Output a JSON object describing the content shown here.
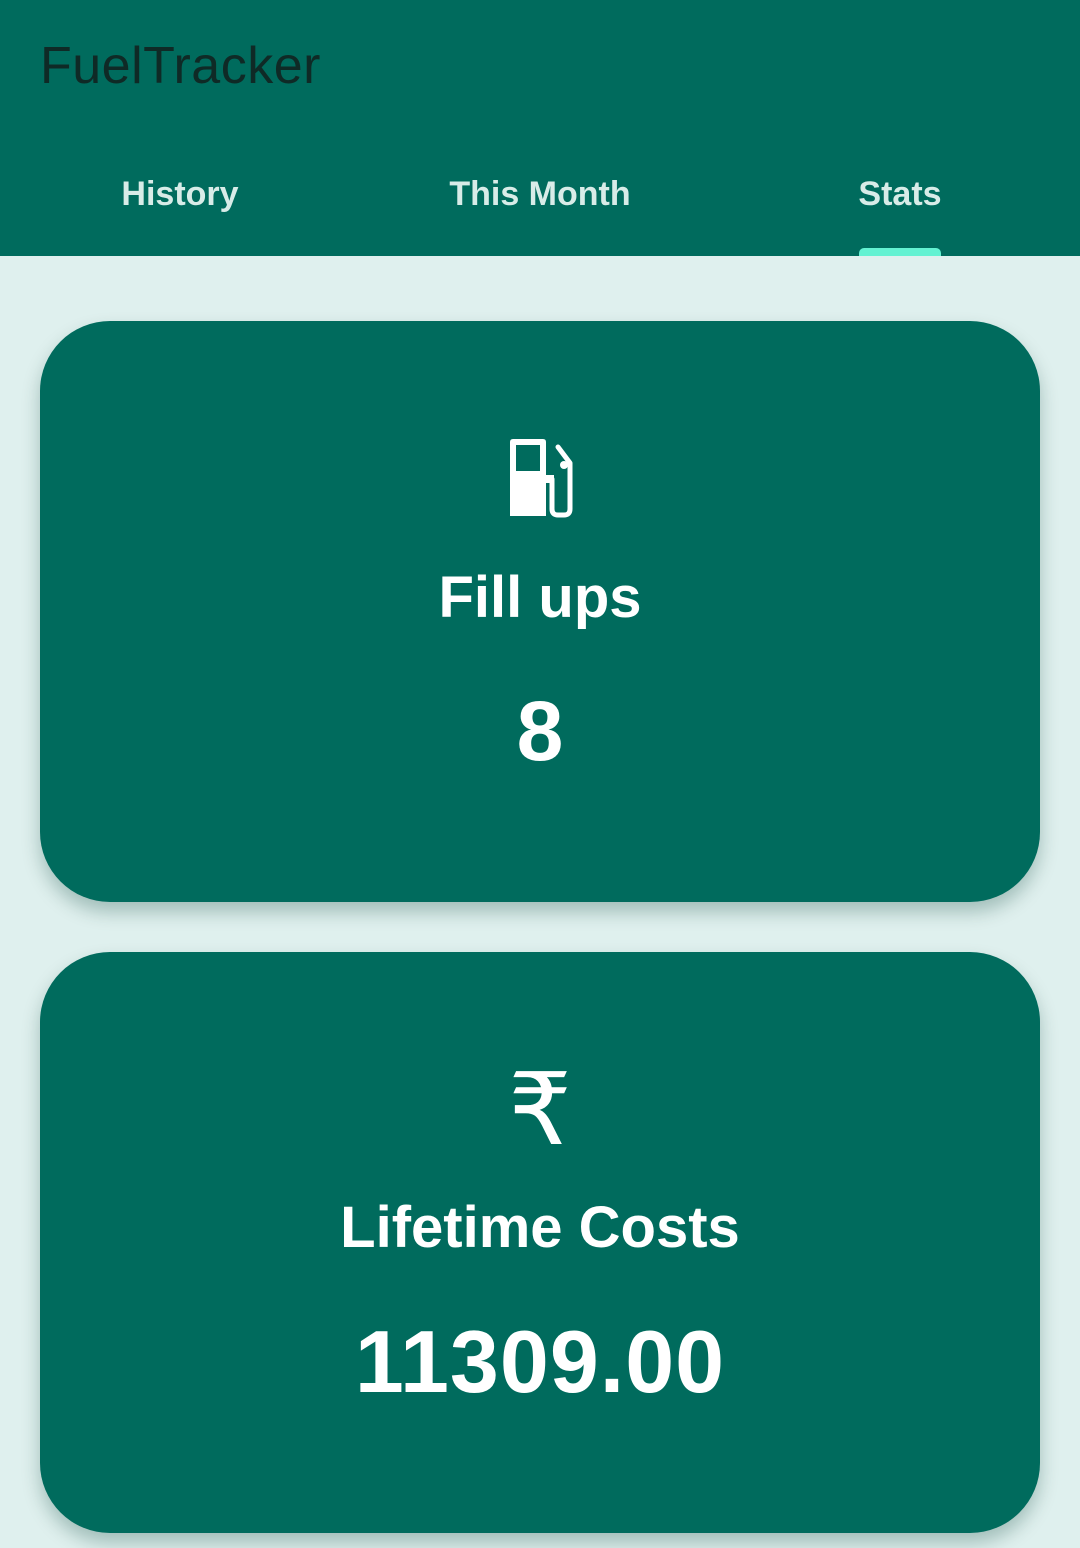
{
  "app": {
    "title": "FuelTracker"
  },
  "tabs": [
    {
      "label": "History",
      "selected": false
    },
    {
      "label": "This Month",
      "selected": false
    },
    {
      "label": "Stats",
      "selected": true
    }
  ],
  "stats": {
    "fill_ups": {
      "icon": "fuel-pump-icon",
      "label": "Fill ups",
      "value": "8"
    },
    "lifetime_costs": {
      "icon": "rupee-icon",
      "symbol": "₹",
      "label": "Lifetime Costs",
      "value": "11309.00"
    }
  },
  "colors": {
    "primary": "#006b5d",
    "background": "#dff0ee",
    "tab_indicator": "#63f2d2",
    "title_text": "#0f2a26",
    "card_text": "#ffffff"
  }
}
